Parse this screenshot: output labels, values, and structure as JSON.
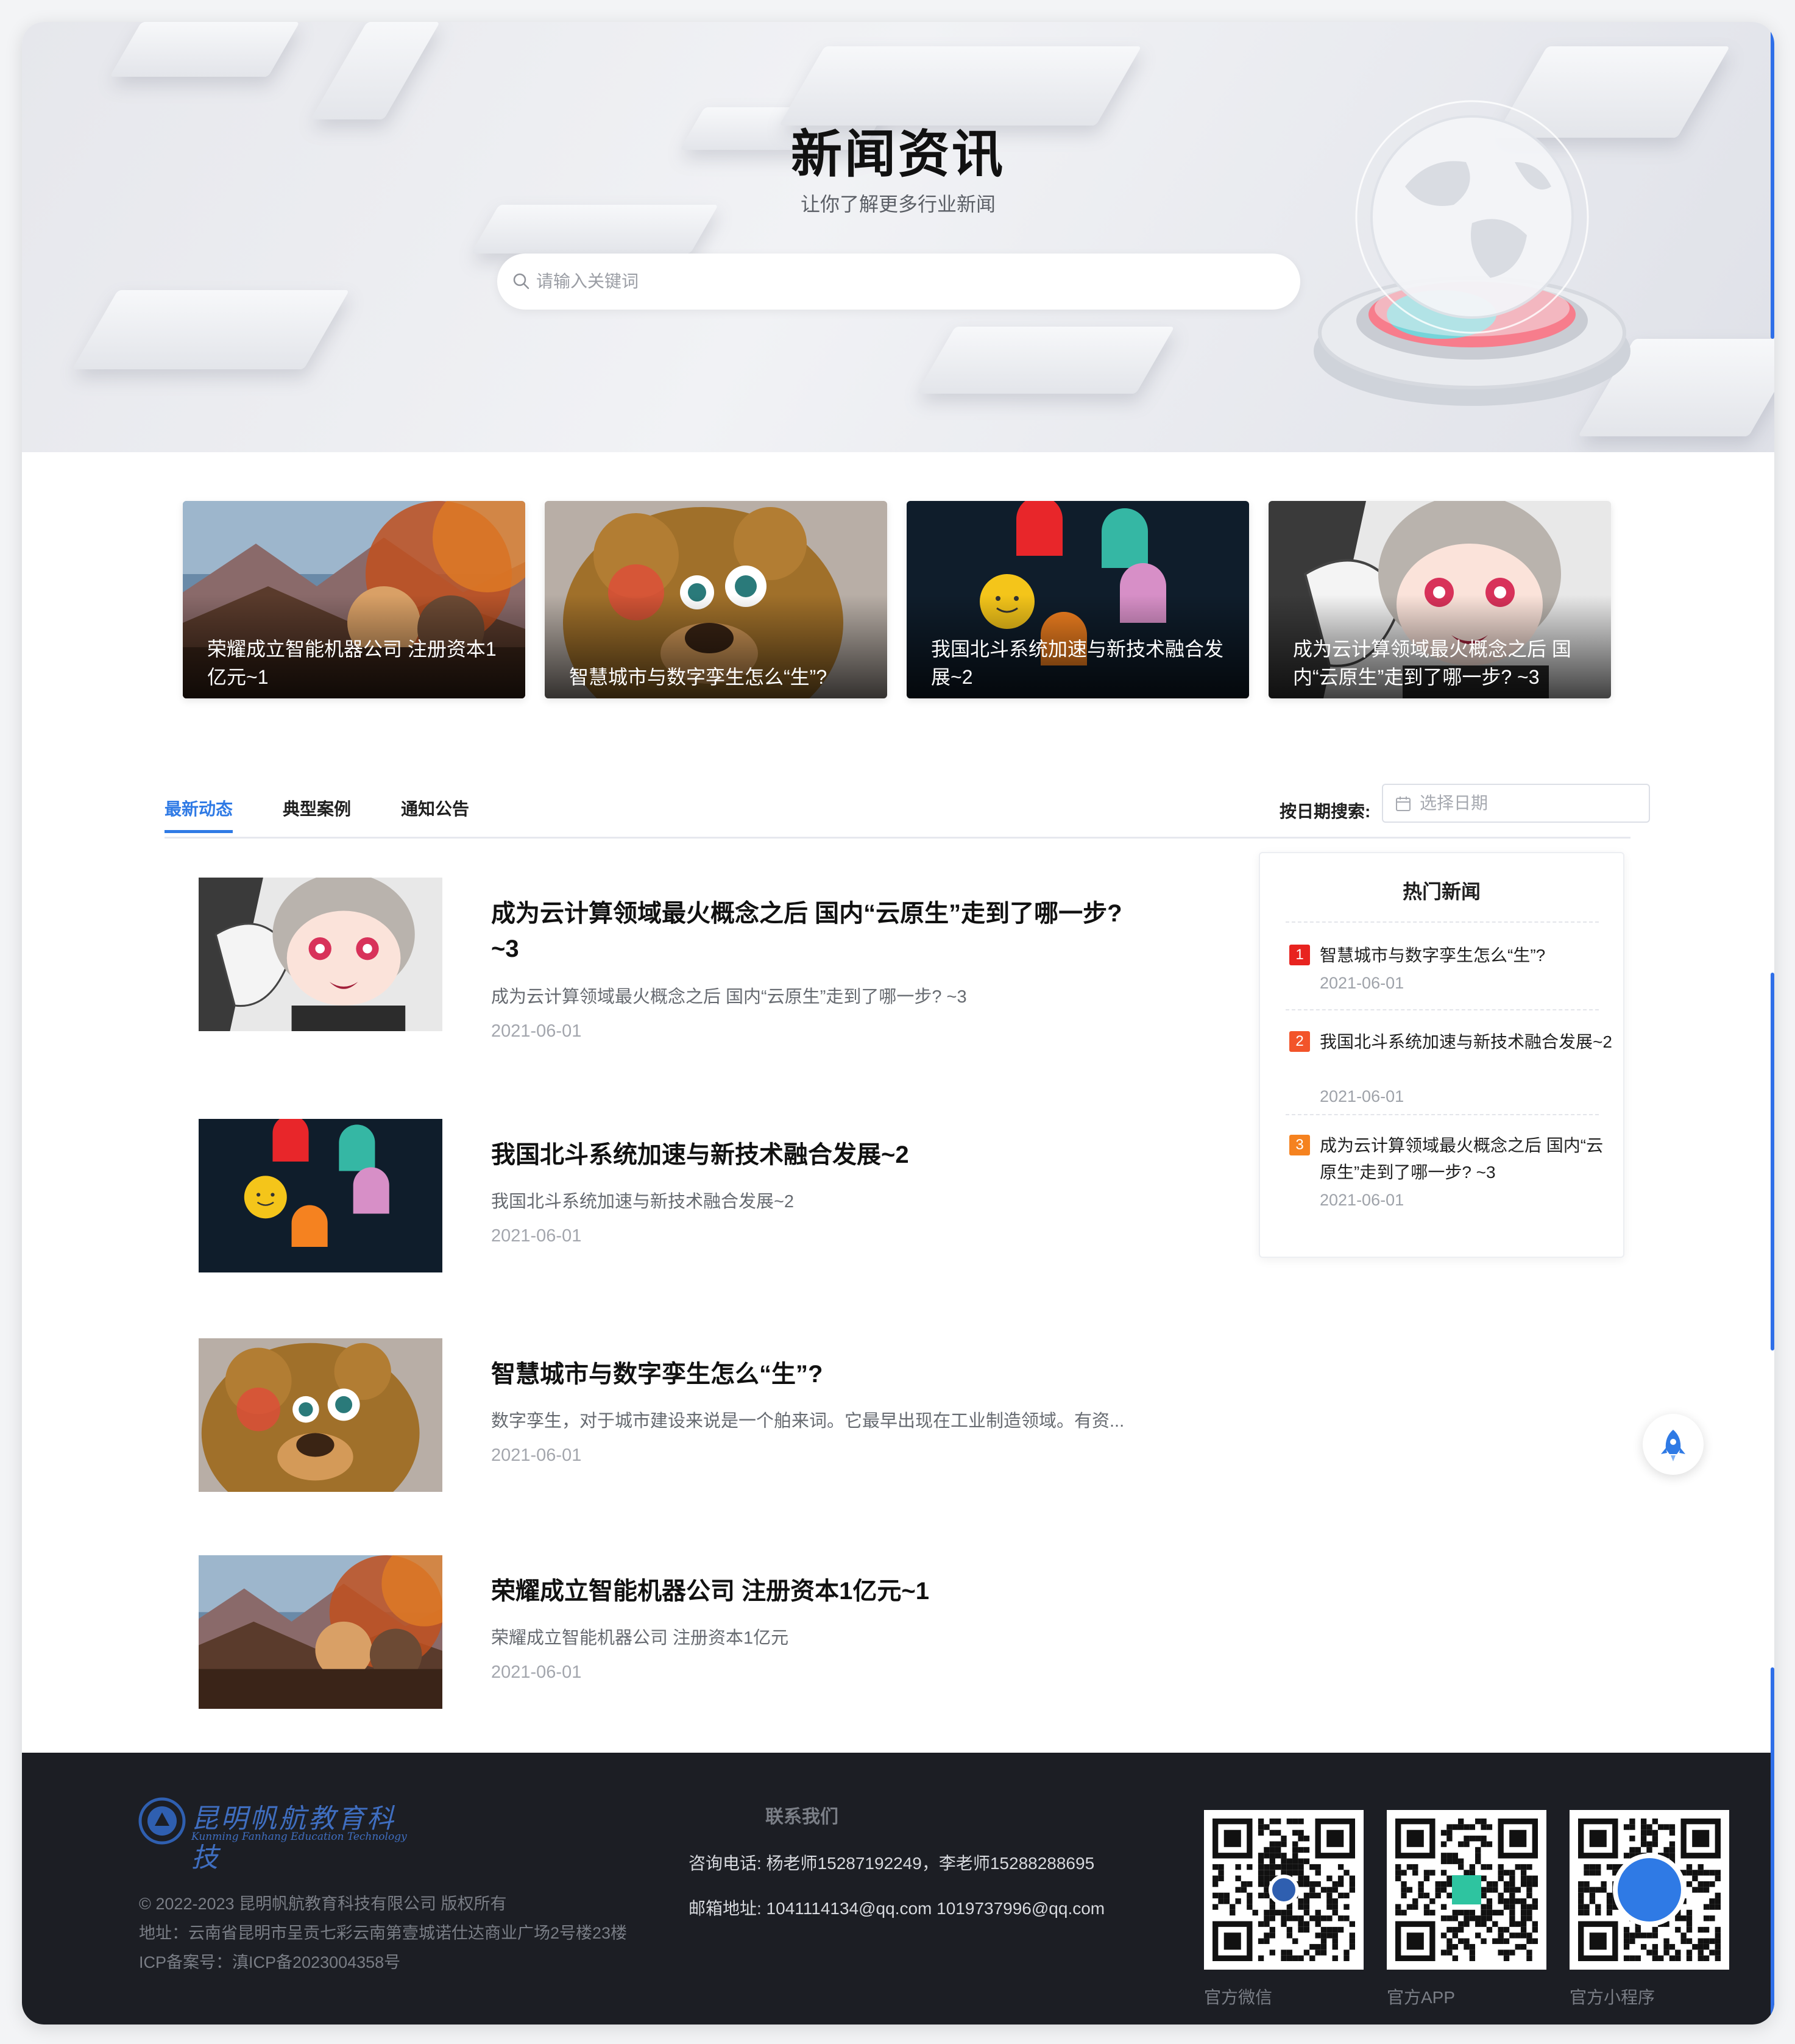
{
  "hero": {
    "title": "新闻资讯",
    "subtitle": "让你了解更多行业新闻",
    "search_placeholder": "请输入关键词"
  },
  "featured": [
    {
      "title": "荣耀成立智能机器公司 注册资本1亿元~1",
      "image": "anime-forest-scene"
    },
    {
      "title": "智慧城市与数字孪生怎么“生”?",
      "image": "cartoon-bear"
    },
    {
      "title": "我国北斗系统加速与新技术融合发展~2",
      "image": "colorful-ghosts"
    },
    {
      "title": "成为云计算领域最火概念之后 国内“云原生”走到了哪一步? ~3",
      "image": "anime-girl-sketch"
    }
  ],
  "tabs": {
    "items": [
      "最新动态",
      "典型案例",
      "通知公告"
    ],
    "active": 0,
    "date_label": "按日期搜索:",
    "date_placeholder": "选择日期"
  },
  "news": [
    {
      "title": "成为云计算领域最火概念之后 国内“云原生”走到了哪一步? ~3",
      "summary": "成为云计算领域最火概念之后 国内“云原生”走到了哪一步? ~3",
      "date": "2021-06-01",
      "image": "anime-girl-sketch"
    },
    {
      "title": "我国北斗系统加速与新技术融合发展~2",
      "summary": "我国北斗系统加速与新技术融合发展~2",
      "date": "2021-06-01",
      "image": "colorful-ghosts"
    },
    {
      "title": "智慧城市与数字孪生怎么“生”?",
      "summary": "数字孪生，对于城市建设来说是一个舶来词。它最早出现在工业制造领域。有资...",
      "date": "2021-06-01",
      "image": "cartoon-bear"
    },
    {
      "title": "荣耀成立智能机器公司 注册资本1亿元~1",
      "summary": "荣耀成立智能机器公司 注册资本1亿元",
      "date": "2021-06-01",
      "image": "anime-forest-scene"
    }
  ],
  "hot_news": {
    "title": "热门新闻",
    "items": [
      {
        "rank": "1",
        "text": "智慧城市与数字孪生怎么“生”?",
        "date": "2021-06-01",
        "color": "#e8231f"
      },
      {
        "rank": "2",
        "text": "我国北斗系统加速与新技术融合发展~2",
        "date": "2021-06-01",
        "color": "#f2542a"
      },
      {
        "rank": "3",
        "text": "成为云计算领域最火概念之后 国内“云原生”走到了哪一步? ~3",
        "date": "2021-06-01",
        "color": "#f5821f"
      }
    ]
  },
  "footer": {
    "logo_cn": "昆明帆航教育科技",
    "logo_en": "Kunming Fanhang Education Technology",
    "copyright": "© 2022-2023 昆明帆航教育科技有限公司 版权所有",
    "address": "地址：云南省昆明市呈贡七彩云南第壹城诺仕达商业广场2号楼23楼",
    "icp": "ICP备案号：滇ICP备2023004358号",
    "contact_title": "联系我们",
    "phone": "咨询电话: 杨老师15287192249，李老师15288288695",
    "email": "邮箱地址: 1041114134@qq.com 1019737996@qq.com",
    "qr_codes": [
      {
        "label": "官方微信",
        "icon": "wechat-qr"
      },
      {
        "label": "官方APP",
        "icon": "app-qr"
      },
      {
        "label": "官方小程序",
        "icon": "mini-program-qr"
      }
    ]
  },
  "colors": {
    "accent": "#2f7ae5",
    "footer_bg": "#1c1e24",
    "rank1": "#e8231f",
    "rank2": "#f2542a",
    "rank3": "#f5821f"
  }
}
